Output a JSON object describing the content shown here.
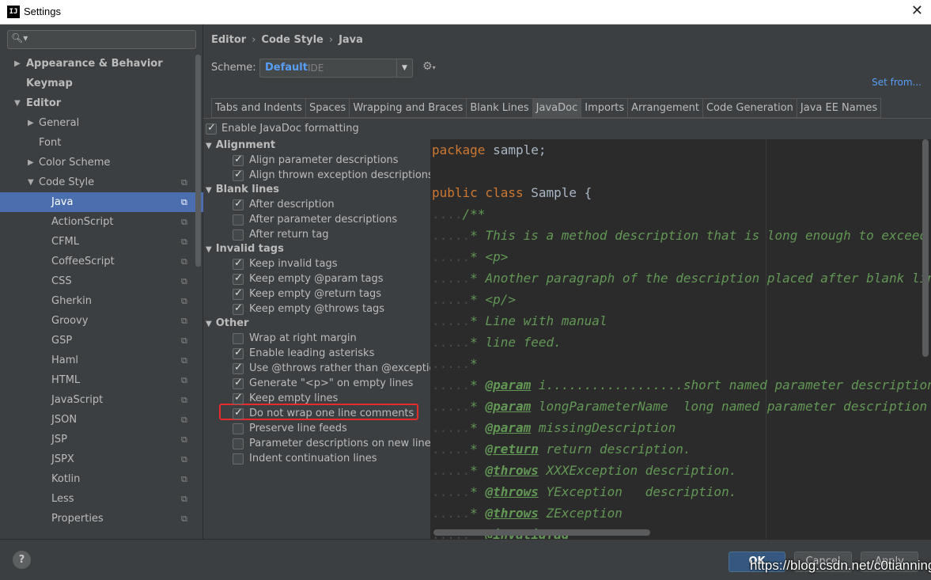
{
  "window": {
    "title": "Settings",
    "app_icon": "IJ"
  },
  "search": {
    "placeholder": ""
  },
  "tree": [
    {
      "label": "Appearance & Behavior",
      "arrow": "▶",
      "bold": true
    },
    {
      "label": "Keymap",
      "arrow": "",
      "bold": true
    },
    {
      "label": "Editor",
      "arrow": "▼",
      "bold": true
    },
    {
      "label": "General",
      "arrow": "▶"
    },
    {
      "label": "Font",
      "arrow": ""
    },
    {
      "label": "Color Scheme",
      "arrow": "▶"
    },
    {
      "label": "Code Style",
      "arrow": "▼",
      "copy": true
    },
    {
      "label": "Java",
      "selected": true,
      "copy": true
    },
    {
      "label": "ActionScript",
      "copy": true
    },
    {
      "label": "CFML",
      "copy": true
    },
    {
      "label": "CoffeeScript",
      "copy": true
    },
    {
      "label": "CSS",
      "copy": true
    },
    {
      "label": "Gherkin",
      "copy": true
    },
    {
      "label": "Groovy",
      "copy": true
    },
    {
      "label": "GSP",
      "copy": true
    },
    {
      "label": "Haml",
      "copy": true
    },
    {
      "label": "HTML",
      "copy": true
    },
    {
      "label": "JavaScript",
      "copy": true
    },
    {
      "label": "JSON",
      "copy": true
    },
    {
      "label": "JSP",
      "copy": true
    },
    {
      "label": "JSPX",
      "copy": true
    },
    {
      "label": "Kotlin",
      "copy": true
    },
    {
      "label": "Less",
      "copy": true
    },
    {
      "label": "Properties",
      "copy": true
    }
  ],
  "breadcrumb": [
    "Editor",
    "Code Style",
    "Java"
  ],
  "scheme": {
    "label": "Scheme:",
    "name": "Default",
    "kind": "IDE",
    "set_from": "Set from..."
  },
  "tabs": [
    "Tabs and Indents",
    "Spaces",
    "Wrapping and Braces",
    "Blank Lines",
    "JavaDoc",
    "Imports",
    "Arrangement",
    "Code Generation",
    "Java EE Names"
  ],
  "active_tab": "JavaDoc",
  "enable_javadoc": {
    "label": "Enable JavaDoc formatting",
    "checked": true
  },
  "groups": [
    {
      "title": "Alignment",
      "items": [
        {
          "label": "Align parameter descriptions",
          "checked": true
        },
        {
          "label": "Align thrown exception descriptions",
          "checked": true
        }
      ]
    },
    {
      "title": "Blank lines",
      "items": [
        {
          "label": "After description",
          "checked": true
        },
        {
          "label": "After parameter descriptions",
          "checked": false
        },
        {
          "label": "After return tag",
          "checked": false
        }
      ]
    },
    {
      "title": "Invalid tags",
      "items": [
        {
          "label": "Keep invalid tags",
          "checked": true
        },
        {
          "label": "Keep empty @param tags",
          "checked": true
        },
        {
          "label": "Keep empty @return tags",
          "checked": true
        },
        {
          "label": "Keep empty @throws tags",
          "checked": true
        }
      ]
    },
    {
      "title": "Other",
      "items": [
        {
          "label": "Wrap at right margin",
          "checked": false
        },
        {
          "label": "Enable leading asterisks",
          "checked": true
        },
        {
          "label": "Use @throws rather than @exception",
          "checked": true
        },
        {
          "label": "Generate \"<p>\" on empty lines",
          "checked": true
        },
        {
          "label": "Keep empty lines",
          "checked": true
        },
        {
          "label": "Do not wrap one line comments",
          "checked": true
        },
        {
          "label": "Preserve line feeds",
          "checked": false
        },
        {
          "label": "Parameter descriptions on new line",
          "checked": false
        },
        {
          "label": "Indent continuation lines",
          "checked": false
        }
      ]
    }
  ],
  "code": {
    "l1_kw": "package",
    "l1_rest": " sample;",
    "l2_kw": "public class",
    "l2_rest": " Sample {",
    "l3": "/**",
    "l4": "* This is a method description that is long enough to exceed right margin.",
    "l5": "* <p>",
    "l6": "* Another paragraph of the description placed after blank line.",
    "l7": "* <p/>",
    "l8": "* Line with manual",
    "l9": "* line feed.",
    "l10": "*",
    "l11_tag": "@param",
    "l11_rest": " i..................short named parameter description",
    "l12_tag": "@param",
    "l12_rest": " longParameterName  long named parameter description",
    "l13_tag": "@param",
    "l13_rest": " missingDescription",
    "l14_tag": "@return",
    "l14_rest": " return description.",
    "l15_tag": "@throws",
    "l15_rest": " XXXException description.",
    "l16_tag": "@throws",
    "l16_rest": " YException   description.",
    "l17_tag": "@throws",
    "l17_rest": " ZException",
    "l18_tag": "@invalidTag",
    "l18_rest": ""
  },
  "buttons": {
    "ok": "OK",
    "cancel": "Cancel",
    "apply": "Apply",
    "help": "?"
  },
  "watermark": "https://blog.csdn.net/c0tianning",
  "colors": {
    "selection": "#4b6eaf",
    "highlight_box": "#e52b2b",
    "link": "#589df6"
  }
}
